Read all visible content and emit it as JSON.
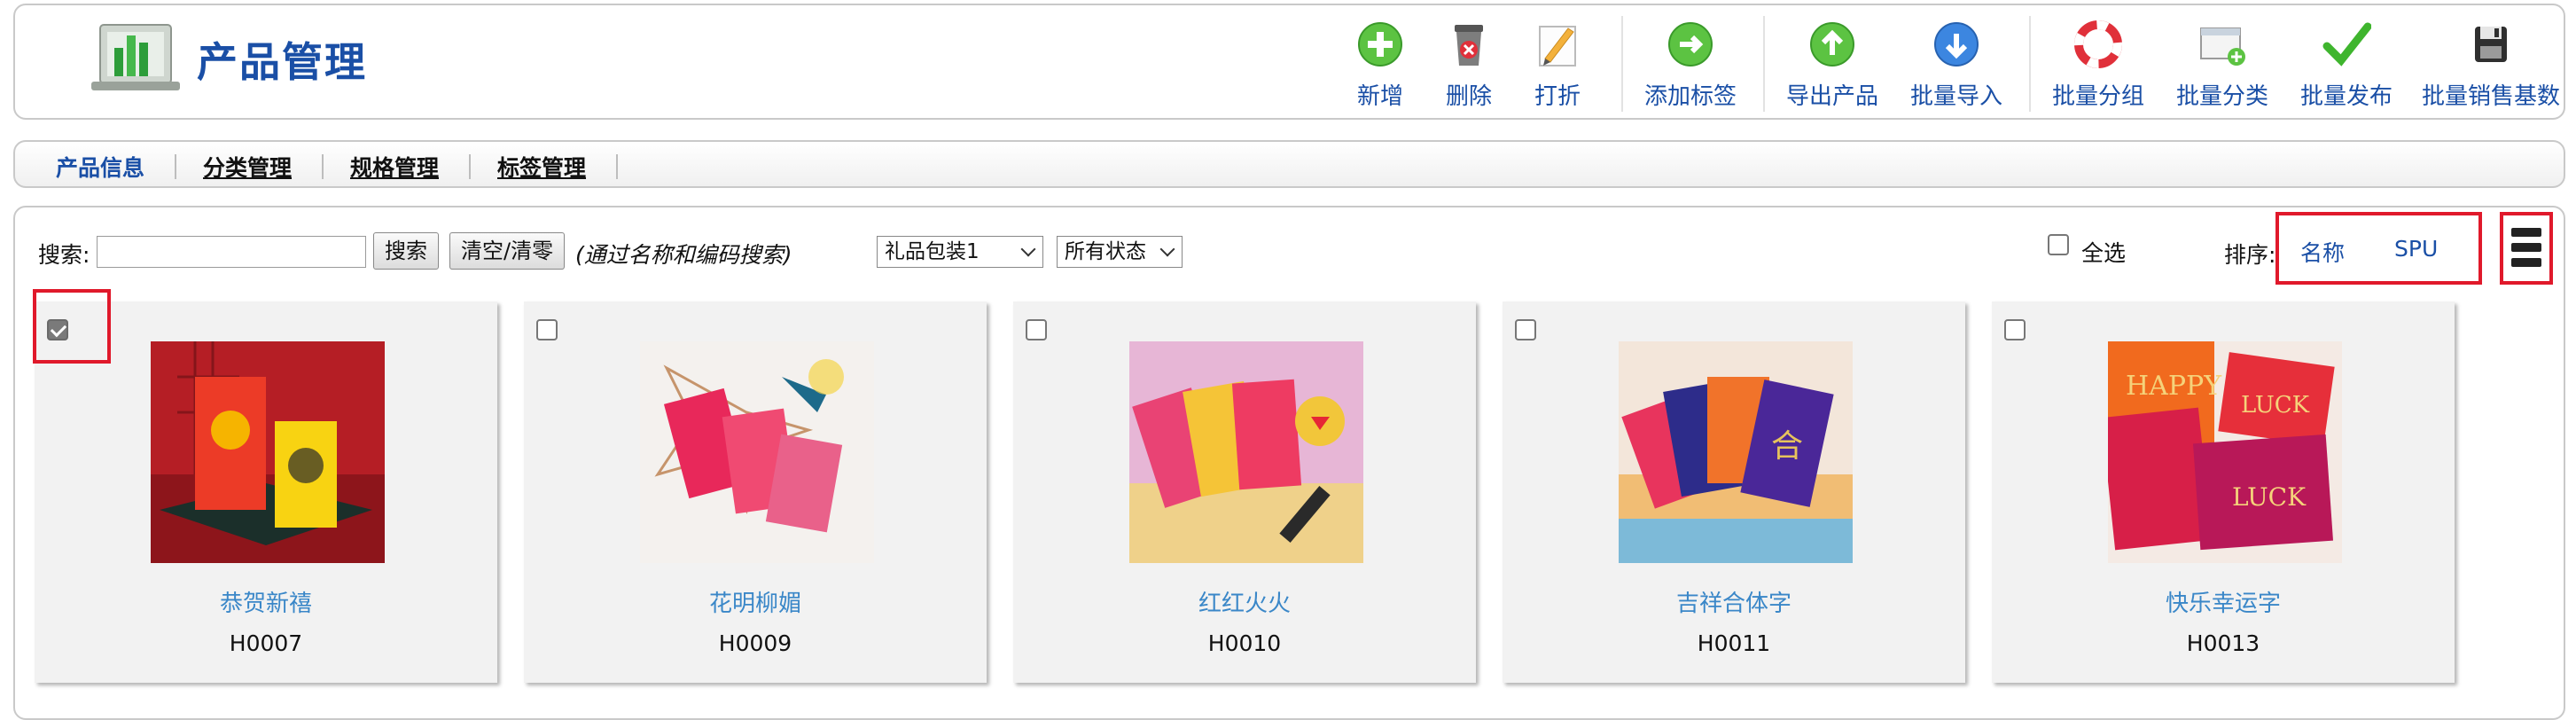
{
  "header": {
    "title": "产品管理",
    "toolbar": [
      {
        "label": "新增",
        "icon": "add-icon"
      },
      {
        "label": "删除",
        "icon": "delete-icon"
      },
      {
        "label": "打折",
        "icon": "discount-icon"
      },
      {
        "label": "添加标签",
        "icon": "add-tag-icon"
      },
      {
        "label": "导出产品",
        "icon": "export-icon"
      },
      {
        "label": "批量导入",
        "icon": "import-icon"
      },
      {
        "label": "批量分组",
        "icon": "group-icon"
      },
      {
        "label": "批量分类",
        "icon": "categorize-icon"
      },
      {
        "label": "批量发布",
        "icon": "publish-icon"
      },
      {
        "label": "批量销售基数",
        "icon": "sales-base-icon"
      }
    ]
  },
  "tabs": [
    {
      "label": "产品信息",
      "active": true
    },
    {
      "label": "分类管理",
      "active": false
    },
    {
      "label": "规格管理",
      "active": false
    },
    {
      "label": "标签管理",
      "active": false
    }
  ],
  "filters": {
    "search_label": "搜索:",
    "search_value": "",
    "search_button": "搜索",
    "clear_button": "清空/清零",
    "search_hint": "(通过名称和编码搜索)",
    "category_select": "礼品包装1",
    "status_select": "所有状态",
    "select_all_label": "全选",
    "sort_label": "排序:",
    "sort_options": [
      "名称",
      "SPU"
    ]
  },
  "products": [
    {
      "name": "恭贺新禧",
      "code": "H0007",
      "checked": true
    },
    {
      "name": "花明柳媚",
      "code": "H0009",
      "checked": false
    },
    {
      "name": "红红火火",
      "code": "H0010",
      "checked": false
    },
    {
      "name": "吉祥合体字",
      "code": "H0011",
      "checked": false
    },
    {
      "name": "快乐幸运字",
      "code": "H0013",
      "checked": false
    }
  ],
  "colors": {
    "accent": "#1a4fa6",
    "link": "#3a87c8",
    "highlight": "#e0192b"
  }
}
